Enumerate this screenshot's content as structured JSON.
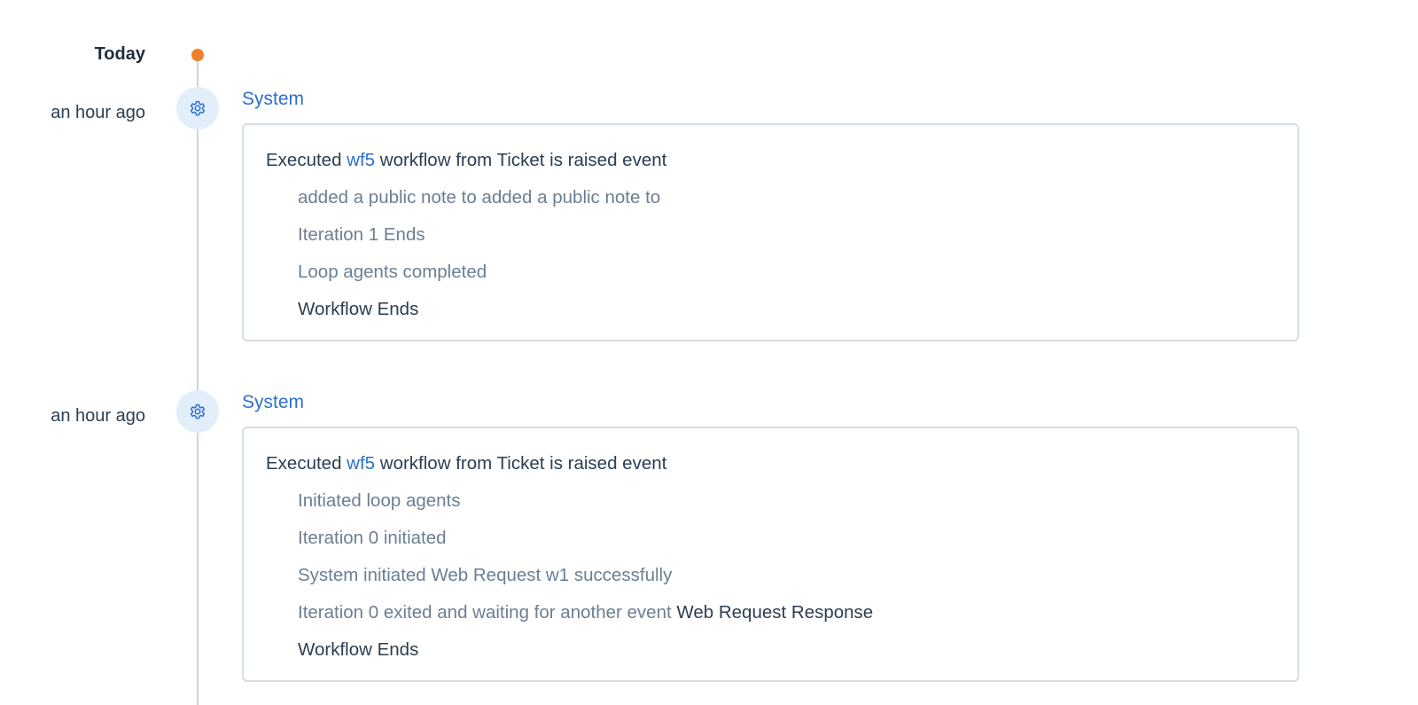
{
  "timeline": {
    "today_label": "Today",
    "accent_color": "#f07f2b",
    "link_color": "#2c6fd1"
  },
  "entries": [
    {
      "time": "an hour ago",
      "icon": "gear-icon",
      "actor": "System",
      "header": {
        "prefix": "Executed ",
        "workflow_link": "wf5",
        "suffix": " workflow from Ticket is raised event"
      },
      "steps": [
        {
          "text": "added a public note to added a public note to",
          "tone": "muted"
        },
        {
          "text": "Iteration 1 Ends",
          "tone": "muted"
        },
        {
          "text": "Loop agents completed",
          "tone": "muted"
        },
        {
          "text": "Workflow Ends",
          "tone": "dark"
        }
      ]
    },
    {
      "time": "an hour ago",
      "icon": "gear-icon",
      "actor": "System",
      "header": {
        "prefix": "Executed ",
        "workflow_link": "wf5",
        "suffix": " workflow from Ticket is raised event"
      },
      "steps": [
        {
          "text": "Initiated loop agents",
          "tone": "muted"
        },
        {
          "text": "Iteration 0 initiated",
          "tone": "muted"
        },
        {
          "text": "System initiated Web Request w1 successfully",
          "tone": "muted"
        },
        {
          "text": "Iteration 0 exited and waiting for another event",
          "tone": "muted",
          "trailing": "Web Request Response"
        },
        {
          "text": "Workflow Ends",
          "tone": "dark"
        }
      ]
    }
  ]
}
